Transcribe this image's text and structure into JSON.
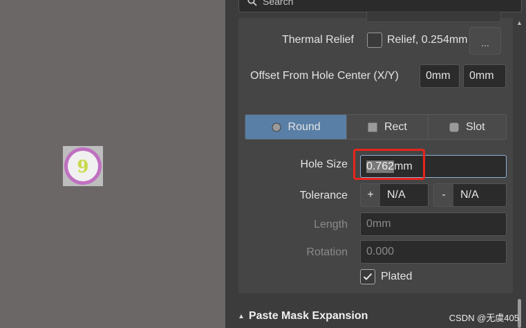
{
  "canvas": {
    "pad_number": "9",
    "pad_color": "#c070c0"
  },
  "panel": {
    "search": {
      "placeholder": "Search"
    },
    "thermal_relief": {
      "label": "Thermal Relief",
      "value": "Relief, 0.254mm",
      "more_button": "...",
      "checked": false
    },
    "offset": {
      "label": "Offset From Hole Center (X/Y)",
      "x": "0mm",
      "y": "0mm"
    },
    "hole_shape": {
      "options": [
        {
          "label": "Round",
          "icon": "circle-icon",
          "active": true
        },
        {
          "label": "Rect",
          "icon": "square-icon",
          "active": false
        },
        {
          "label": "Slot",
          "icon": "rounded-square-icon",
          "active": false
        }
      ],
      "active_color": "#5a7fa6"
    },
    "hole_size": {
      "label": "Hole Size",
      "value_selected": "0.762",
      "value_unit": "mm",
      "highlight_color": "#e8241c"
    },
    "tolerance": {
      "label": "Tolerance",
      "plus_sign": "+",
      "plus_value": "N/A",
      "minus_sign": "-",
      "minus_value": "N/A"
    },
    "length": {
      "label": "Length",
      "value": "0mm"
    },
    "rotation": {
      "label": "Rotation",
      "value": "0.000"
    },
    "plated": {
      "label": "Plated",
      "checked": true
    },
    "paste_mask": {
      "label": "Paste Mask Expansion"
    }
  },
  "watermark": "CSDN @无虞405"
}
